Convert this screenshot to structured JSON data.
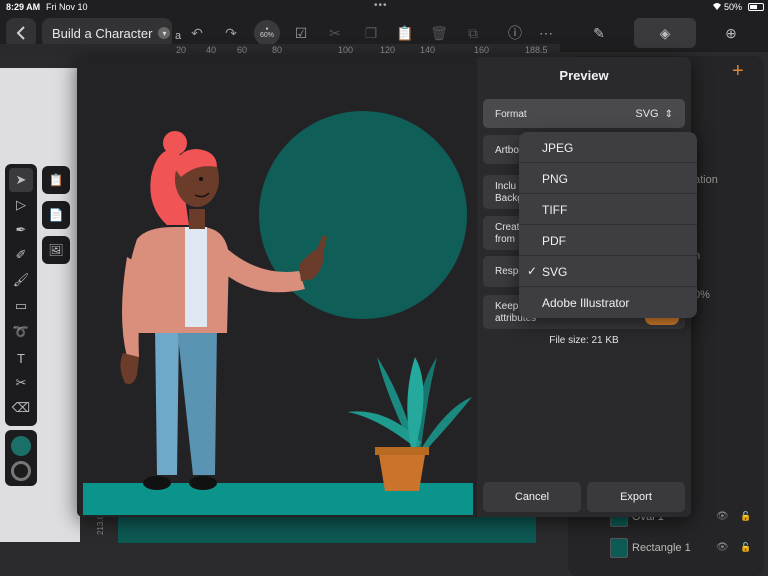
{
  "status": {
    "time": "8:29 AM",
    "date": "Fri Nov 10",
    "battery": "50%",
    "dots": "•••"
  },
  "toolbar": {
    "doc_title": "Build a Character",
    "after_title": "a",
    "zoom": "60%",
    "back_icon": "chevron-left-icon"
  },
  "ruler": {
    "ticks": [
      "20",
      "40",
      "60",
      "80",
      "100",
      "120",
      "140",
      "160",
      "188.5"
    ],
    "vertical": "213.8"
  },
  "layers": {
    "peek_ation": "ation",
    "peek_n": "n",
    "peek_pct": "0%",
    "rows": [
      {
        "label": "Oval 1"
      },
      {
        "label": "Rectangle 1"
      }
    ]
  },
  "preview": {
    "title": "Preview",
    "format_label": "Format",
    "format_value": "SVG",
    "artboard_label": "Artbo",
    "include_label_1": "Inclu",
    "include_label_2": "Backg",
    "create_label_1": "Creat",
    "create_label_2": "from",
    "respect_label": "Respe",
    "keep_label_1": "Keep",
    "keep_label_2": "attributes",
    "file_size": "File size:  21 KB",
    "cancel": "Cancel",
    "export": "Export"
  },
  "dropdown": {
    "options": [
      "JPEG",
      "PNG",
      "TIFF",
      "PDF",
      "SVG",
      "Adobe Illustrator"
    ],
    "selected_index": 4,
    "check": "✓"
  },
  "colors": {
    "accent": "#e0872e",
    "teal": "#1a6f69",
    "hair": "#f05454",
    "skin": "#6b3c2a"
  }
}
